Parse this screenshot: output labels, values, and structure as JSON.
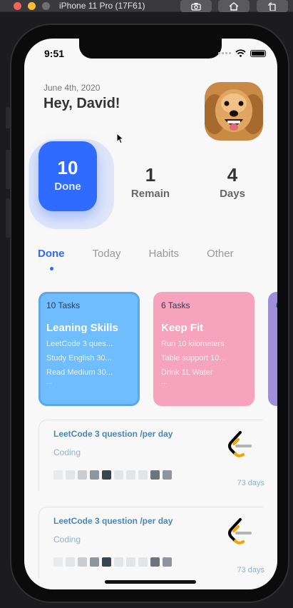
{
  "window": {
    "title": "iPhone 11 Pro (17F61)"
  },
  "toolbar": {
    "icons": [
      "screenshot-icon",
      "home-icon",
      "rotate-icon"
    ]
  },
  "status": {
    "time": "9:51"
  },
  "header": {
    "date": "June 4th, 2020",
    "greeting": "Hey, David!"
  },
  "stats": {
    "done": {
      "value": "10",
      "label": "Done"
    },
    "remain": {
      "value": "1",
      "label": "Remain"
    },
    "days": {
      "value": "4",
      "label": "Days"
    }
  },
  "tabs": [
    {
      "label": "Done",
      "active": true
    },
    {
      "label": "Today",
      "active": false
    },
    {
      "label": "Habits",
      "active": false
    },
    {
      "label": "Other",
      "active": false
    }
  ],
  "cards": [
    {
      "count": "10 Tasks",
      "title": "Leaning Skills",
      "items": [
        "LeetCode 3 ques...",
        "Study English 30...",
        "Read Medium 30..."
      ],
      "more": "...",
      "color": "#6fbdfc"
    },
    {
      "count": "6 Tasks",
      "title": "Keep Fit",
      "items": [
        "Run 10 kilometers",
        "Table support 10...",
        "Drink 1L Water"
      ],
      "more": "...",
      "color": "#f6a3bd"
    },
    {
      "count": "6",
      "color": "#9f8fd8"
    }
  ],
  "habits": [
    {
      "title": "LeetCode 3 question /per day",
      "category": "Coding",
      "days": "73 days",
      "logo": "leetcode-logo-icon",
      "grid": [
        "#e9eaed",
        "#e3e4e7",
        "#c9cdd2",
        "#8f959c",
        "#3a4450",
        "#e3e4e7",
        "#e3e4e7",
        "#e3e4e7",
        "#6d747c",
        "#8f959c"
      ]
    },
    {
      "title": "LeetCode 3 question /per day",
      "category": "Coding",
      "days": "73 days",
      "logo": "leetcode-logo-icon",
      "grid": [
        "#e9eaed",
        "#e3e4e7",
        "#c9cdd2",
        "#8f959c",
        "#3a4450",
        "#e3e4e7",
        "#e3e4e7",
        "#e3e4e7",
        "#6d747c",
        "#8f959c"
      ]
    }
  ],
  "colors": {
    "accent": "#2f6bff",
    "habit_title": "#4a86bc",
    "habit_muted": "#8fb3d4"
  }
}
